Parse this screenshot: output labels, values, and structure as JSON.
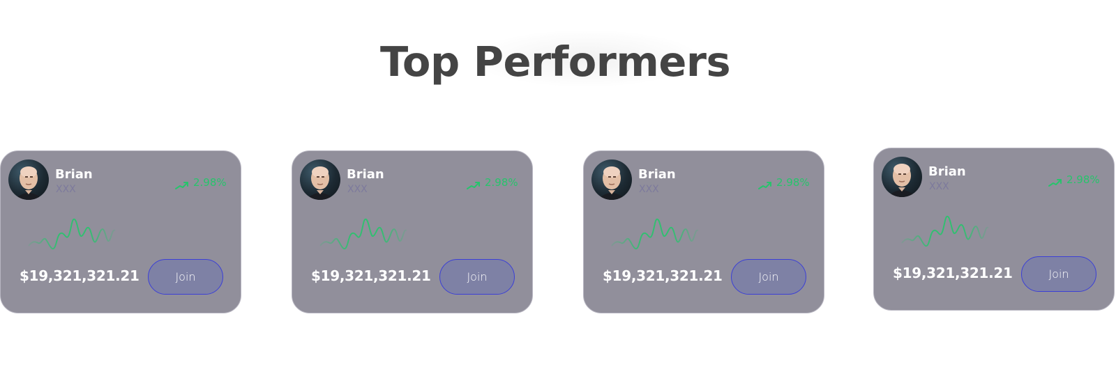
{
  "page": {
    "title": "Top Performers"
  },
  "colors": {
    "card_bg": "#918f9b",
    "accent_green": "#27c46c",
    "button_border": "#3b3fd6",
    "handle": "#7d7a9c"
  },
  "cards": [
    {
      "name": "Brian",
      "handle": "XXX",
      "change": "2.98%",
      "trend_icon": "trend-up-icon",
      "amount": "$19,321,321.21",
      "join_label": "Join"
    },
    {
      "name": "Brian",
      "handle": "XXX",
      "change": "2.98%",
      "trend_icon": "trend-up-icon",
      "amount": "$19,321,321.21",
      "join_label": "Join"
    },
    {
      "name": "Brian",
      "handle": "XXX",
      "change": "2.98%",
      "trend_icon": "trend-up-icon",
      "amount": "$19,321,321.21",
      "join_label": "Join"
    },
    {
      "name": "Brian",
      "handle": "XXX",
      "change": "2.98%",
      "trend_icon": "trend-up-icon",
      "amount": "$19,321,321.21",
      "join_label": "Join"
    }
  ]
}
